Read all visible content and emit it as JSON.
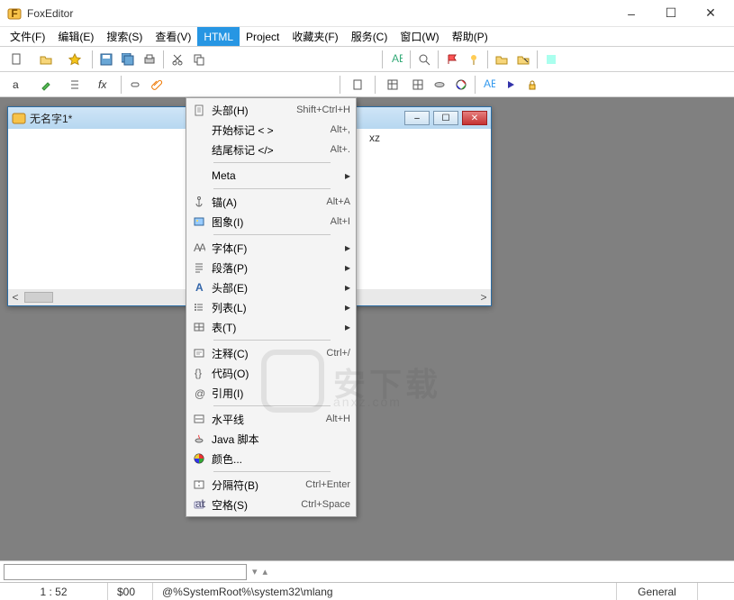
{
  "window": {
    "title": "FoxEditor",
    "minimize": "–",
    "maximize": "☐",
    "close": "✕"
  },
  "menubar": [
    {
      "label": "文件(F)"
    },
    {
      "label": "编辑(E)"
    },
    {
      "label": "搜索(S)"
    },
    {
      "label": "查看(V)"
    },
    {
      "label": "HTML",
      "active": true
    },
    {
      "label": "Project"
    },
    {
      "label": "收藏夹(F)"
    },
    {
      "label": "服务(C)"
    },
    {
      "label": "窗口(W)"
    },
    {
      "label": "帮助(P)"
    }
  ],
  "editor": {
    "tab_title": "无名字1*",
    "phantom_text": "xz"
  },
  "dropdown": [
    {
      "type": "item",
      "icon": "doc",
      "label": "头部(H)",
      "shortcut": "Shift+Ctrl+H"
    },
    {
      "type": "item",
      "icon": "",
      "label": "开始标记 < >",
      "shortcut": "Alt+,"
    },
    {
      "type": "item",
      "icon": "",
      "label": "结尾标记 </>",
      "shortcut": "Alt+."
    },
    {
      "type": "sep"
    },
    {
      "type": "item",
      "icon": "",
      "label": "Meta",
      "submenu": true
    },
    {
      "type": "sep"
    },
    {
      "type": "item",
      "icon": "anchor",
      "label": "锚(A)",
      "shortcut": "Alt+A"
    },
    {
      "type": "item",
      "icon": "image",
      "label": "图象(I)",
      "shortcut": "Alt+I"
    },
    {
      "type": "sep"
    },
    {
      "type": "item",
      "icon": "font",
      "label": "字体(F)",
      "submenu": true
    },
    {
      "type": "item",
      "icon": "para",
      "label": "段落(P)",
      "submenu": true
    },
    {
      "type": "item",
      "icon": "head",
      "label": "头部(E)",
      "submenu": true
    },
    {
      "type": "item",
      "icon": "list",
      "label": "列表(L)",
      "submenu": true
    },
    {
      "type": "item",
      "icon": "table",
      "label": "表(T)",
      "submenu": true
    },
    {
      "type": "sep"
    },
    {
      "type": "item",
      "icon": "comment",
      "label": "注释(C)",
      "shortcut": "Ctrl+/"
    },
    {
      "type": "item",
      "icon": "code",
      "label": "代码(O)"
    },
    {
      "type": "item",
      "icon": "quote",
      "label": "引用(I)"
    },
    {
      "type": "sep"
    },
    {
      "type": "item",
      "icon": "hr",
      "label": "水平线",
      "shortcut": "Alt+H"
    },
    {
      "type": "item",
      "icon": "java",
      "label": "Java 脚本"
    },
    {
      "type": "item",
      "icon": "color",
      "label": "颜色..."
    },
    {
      "type": "sep"
    },
    {
      "type": "item",
      "icon": "divider",
      "label": "分隔符(B)",
      "shortcut": "Ctrl+Enter"
    },
    {
      "type": "item",
      "icon": "space",
      "label": "空格(S)",
      "shortcut": "Ctrl+Space"
    }
  ],
  "watermark": {
    "text": "安下载",
    "sub": "anxz.com"
  },
  "statusbar": {
    "position": "1 : 52",
    "code": "$00",
    "path": "@%SystemRoot%\\system32\\mlang",
    "mode": "General"
  },
  "search": {
    "placeholder": ""
  }
}
